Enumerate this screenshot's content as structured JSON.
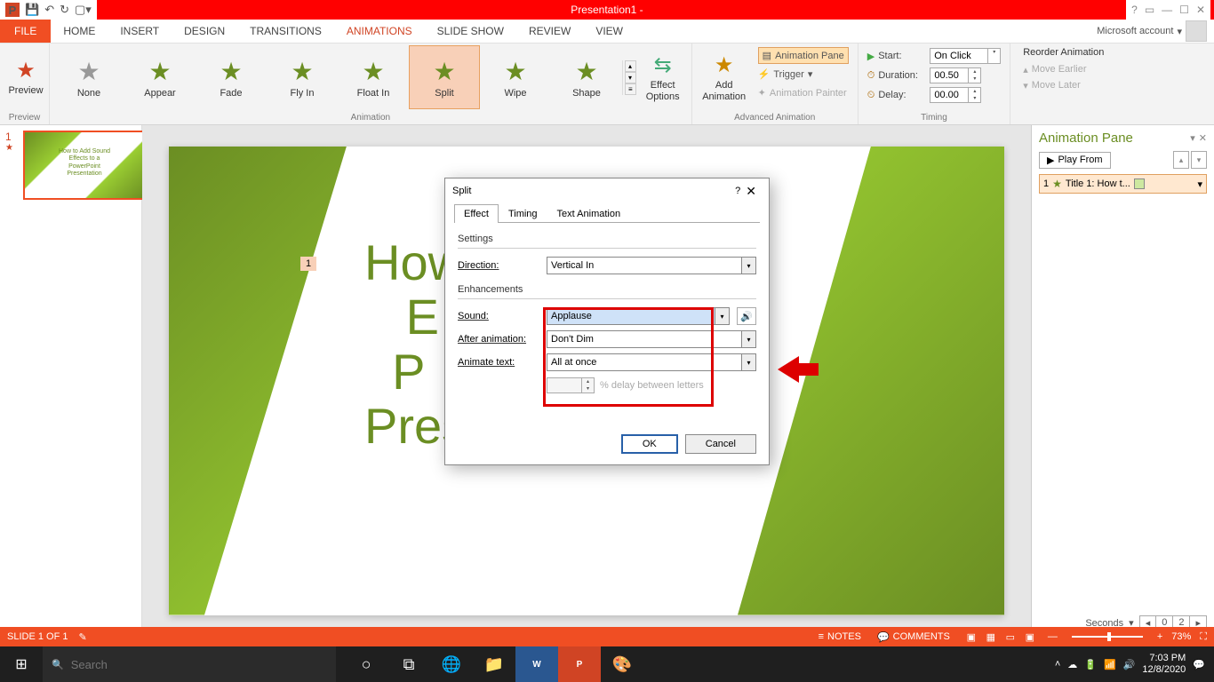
{
  "titlebar": {
    "title": "Presentation1 -"
  },
  "menubar": {
    "file": "FILE",
    "tabs": [
      "HOME",
      "INSERT",
      "DESIGN",
      "TRANSITIONS",
      "ANIMATIONS",
      "SLIDE SHOW",
      "REVIEW",
      "VIEW"
    ],
    "active_index": 4,
    "account": "Microsoft account"
  },
  "ribbon": {
    "preview": {
      "label": "Preview",
      "group": "Preview"
    },
    "animations": {
      "items": [
        "None",
        "Appear",
        "Fade",
        "Fly In",
        "Float In",
        "Split",
        "Wipe",
        "Shape"
      ],
      "selected_index": 5,
      "group": "Animation",
      "effect_options": "Effect\nOptions"
    },
    "advanced": {
      "add": "Add\nAnimation",
      "pane": "Animation Pane",
      "trigger": "Trigger",
      "painter": "Animation Painter",
      "group": "Advanced Animation"
    },
    "timing": {
      "start_label": "Start:",
      "start_value": "On Click",
      "duration_label": "Duration:",
      "duration_value": "00.50",
      "delay_label": "Delay:",
      "delay_value": "00.00",
      "group": "Timing"
    },
    "reorder": {
      "title": "Reorder Animation",
      "earlier": "Move Earlier",
      "later": "Move Later"
    }
  },
  "thumb": {
    "num": "1",
    "text": "How to Add Sound\nEffects to a\nPowerPoint\nPresentation"
  },
  "slide": {
    "num_tag": "1",
    "title": "How\nE\nP\nPresentation"
  },
  "anim_pane": {
    "title": "Animation Pane",
    "play": "Play From",
    "item": {
      "num": "1",
      "label": "Title 1: How t..."
    },
    "seconds": "Seconds",
    "page_from": "0",
    "page_to": "2"
  },
  "dialog": {
    "title": "Split",
    "tabs": [
      "Effect",
      "Timing",
      "Text Animation"
    ],
    "active_tab": 0,
    "settings": "Settings",
    "direction_label": "Direction:",
    "direction_value": "Vertical In",
    "enhancements": "Enhancements",
    "sound_label": "Sound:",
    "sound_value": "Applause",
    "after_label": "After animation:",
    "after_value": "Don't Dim",
    "animate_label": "Animate text:",
    "animate_value": "All at once",
    "delay_note": "% delay between letters",
    "ok": "OK",
    "cancel": "Cancel"
  },
  "statusbar": {
    "slide": "SLIDE 1 OF 1",
    "notes": "NOTES",
    "comments": "COMMENTS",
    "zoom": "73%"
  },
  "taskbar": {
    "search": "Search",
    "time": "7:03 PM",
    "date": "12/8/2020"
  }
}
